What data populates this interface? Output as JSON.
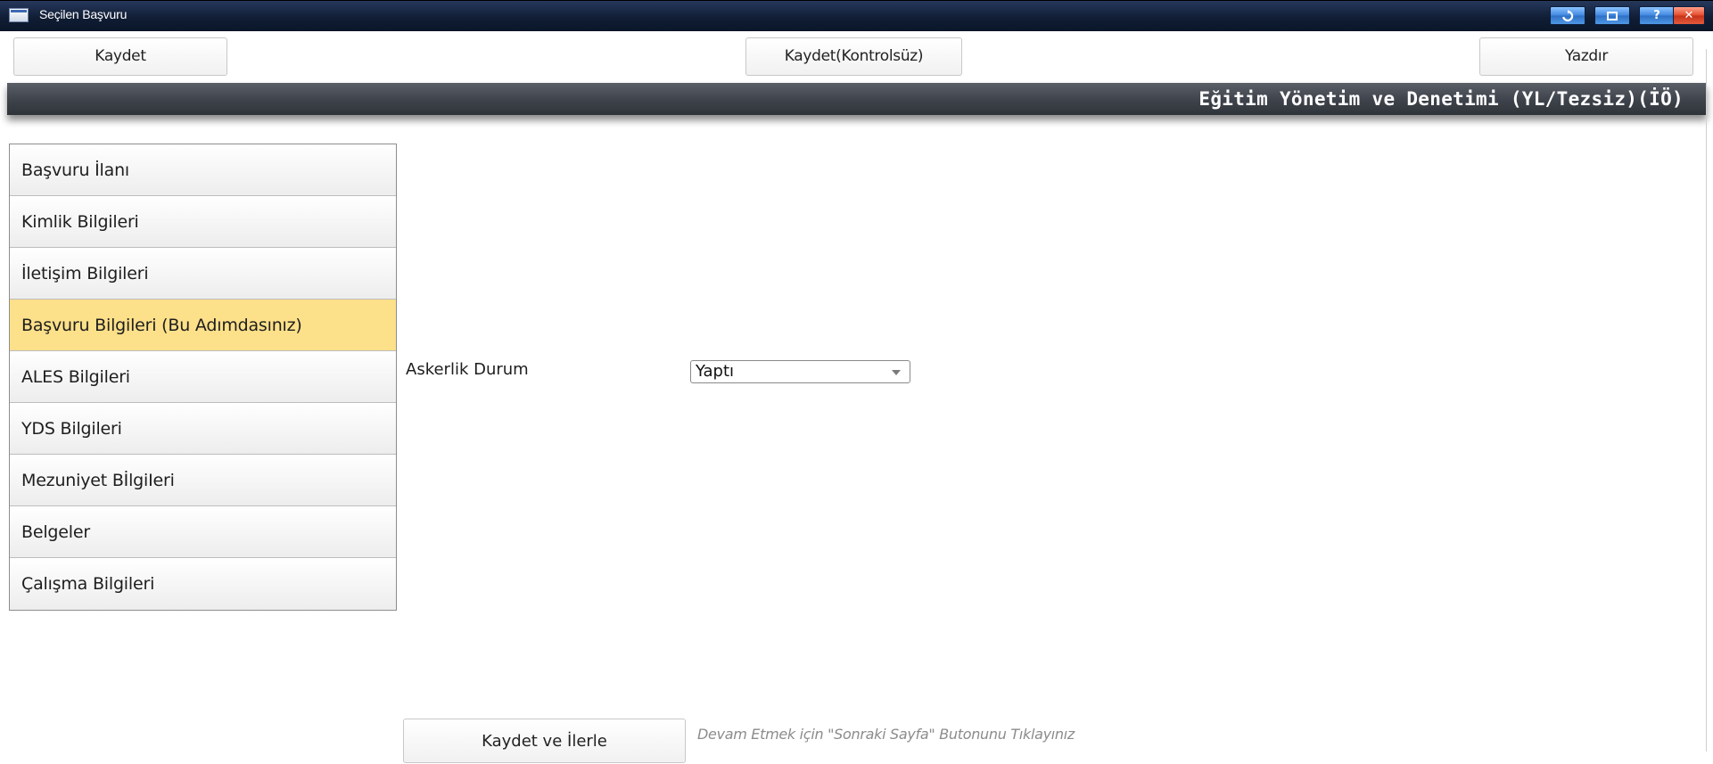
{
  "window": {
    "title": "Seçilen Başvuru",
    "controls": [
      "refresh-icon",
      "restore-icon",
      "help-icon",
      "close-icon"
    ],
    "help_glyph": "?",
    "close_glyph": "✕"
  },
  "toolbar": {
    "save_label": "Kaydet",
    "save_unchecked_label": "Kaydet(Kontrolsüz)",
    "print_label": "Yazdır"
  },
  "section": {
    "title": "Eğitim Yönetim ve Denetimi (YL/Tezsiz)(İÖ)"
  },
  "sidebar": {
    "items": [
      {
        "label": "Başvuru İlanı",
        "active": false
      },
      {
        "label": "Kimlik Bilgileri",
        "active": false
      },
      {
        "label": "İletişim Bilgileri",
        "active": false
      },
      {
        "label": "Başvuru Bilgileri (Bu Adımdasınız)",
        "active": true
      },
      {
        "label": "ALES Bilgileri",
        "active": false
      },
      {
        "label": "YDS Bilgileri",
        "active": false
      },
      {
        "label": "Mezuniyet BİlgiIeri",
        "active": false
      },
      {
        "label": "Belgeler",
        "active": false
      },
      {
        "label": "Çalışma Bilgileri",
        "active": false
      }
    ]
  },
  "form": {
    "military_label": "Askerlik Durum",
    "military_value": "Yaptı"
  },
  "footer": {
    "next_label": "Kaydet ve İlerle",
    "hint": "Devam Etmek için \"Sonraki Sayfa\" Butonunu Tıklayınız"
  },
  "colors": {
    "active_item": "#fde08a",
    "titlebar": "#0f1c33",
    "section_bar": "#3e424a"
  }
}
